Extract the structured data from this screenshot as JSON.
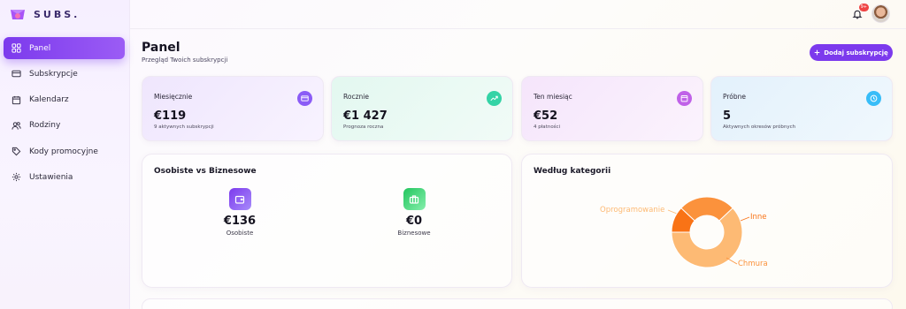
{
  "brand": {
    "name": "SUBS."
  },
  "topbar": {
    "notification_count": "9+"
  },
  "sidebar": {
    "items": [
      {
        "label": "Panel",
        "icon": "grid-icon",
        "active": true
      },
      {
        "label": "Subskrypcje",
        "icon": "card-icon",
        "active": false
      },
      {
        "label": "Kalendarz",
        "icon": "calendar-icon",
        "active": false
      },
      {
        "label": "Rodziny",
        "icon": "users-icon",
        "active": false
      },
      {
        "label": "Kody promocyjne",
        "icon": "tag-icon",
        "active": false
      },
      {
        "label": "Ustawienia",
        "icon": "gear-icon",
        "active": false
      }
    ]
  },
  "header": {
    "title": "Panel",
    "subtitle": "Przegląd Twoich subskrypcji",
    "add_button": "Dodaj subskrypcję"
  },
  "stats": [
    {
      "label": "Miesięcznie",
      "value": "€119",
      "note": "9 aktywnych subskrypcji",
      "icon": "card-icon",
      "color": "#8b5cf6"
    },
    {
      "label": "Rocznie",
      "value": "€1 427",
      "note": "Prognoza roczna",
      "icon": "trend-up-icon",
      "color": "#34d3a6"
    },
    {
      "label": "Ten miesiąc",
      "value": "€52",
      "note": "4 płatności",
      "icon": "calendar-icon",
      "color": "#c062e8"
    },
    {
      "label": "Próbne",
      "value": "5",
      "note": "Aktywnych okresów próbnych",
      "icon": "clock-icon",
      "color": "#38bdf8"
    }
  ],
  "personal_vs_business": {
    "title": "Osobiste vs Biznesowe",
    "personal": {
      "value": "€136",
      "label": "Osobiste",
      "icon": "wallet-icon",
      "color": "#8b5cf6"
    },
    "business": {
      "value": "€0",
      "label": "Biznesowe",
      "icon": "briefcase-icon",
      "color": "#4ade80"
    }
  },
  "categories": {
    "title": "Według kategorii",
    "chart_data": {
      "type": "pie",
      "categories": [
        "Oprogramowanie",
        "Inne",
        "Chmura"
      ],
      "values": [
        62,
        12,
        26
      ],
      "colors": [
        "#fdba74",
        "#f97316",
        "#fb923c"
      ]
    }
  }
}
